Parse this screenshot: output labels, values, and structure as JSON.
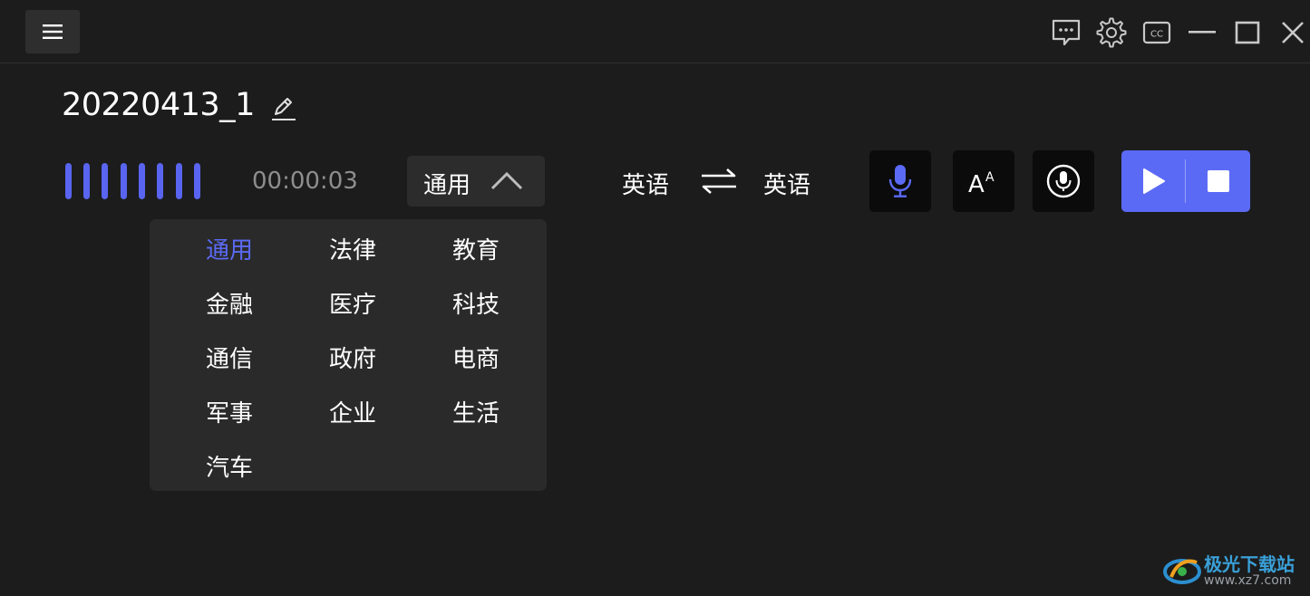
{
  "titlebar": {
    "menu_icon": "hamburger-menu-icon",
    "icons": [
      "feedback-icon",
      "gear-icon",
      "cc-icon",
      "minimize-icon",
      "maximize-icon",
      "close-icon"
    ]
  },
  "document": {
    "title": "20220413_1",
    "edit_icon": "pencil-edit-icon"
  },
  "recording": {
    "elapsed": "00:00:03"
  },
  "domain": {
    "selected": "通用",
    "expanded": true,
    "options": [
      "通用",
      "法律",
      "教育",
      "金融",
      "医疗",
      "科技",
      "通信",
      "政府",
      "电商",
      "军事",
      "企业",
      "生活",
      "汽车"
    ]
  },
  "language": {
    "source": "英语",
    "target": "英语",
    "swap_icon": "swap-arrows-icon"
  },
  "tools": {
    "mic_icon": "microphone-icon",
    "font_icon": "font-size-icon",
    "voice_icon": "voice-input-icon",
    "play_icon": "play-icon",
    "stop_icon": "stop-icon"
  },
  "colors": {
    "accent": "#5b6af5",
    "background": "#1c1c1c",
    "panel": "#2a2a2a"
  },
  "watermark": {
    "name": "极光下载站",
    "url": "www.xz7.com"
  }
}
